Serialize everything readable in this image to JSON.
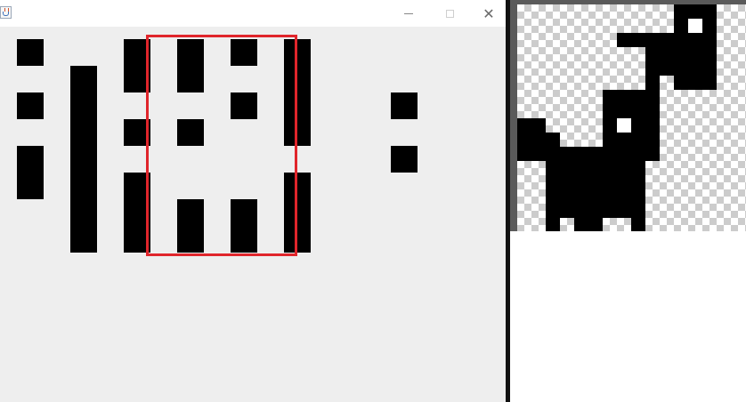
{
  "window": {
    "title": "",
    "icon": "java-cup-icon",
    "buttons": {
      "minimize": "minimize-icon",
      "maximize": "maximize-icon",
      "close": "close-icon"
    },
    "close_glyph": "✕"
  },
  "canvas": {
    "background": "#eeeeee",
    "block_color": "#000000",
    "selection_color": "#e0252b"
  },
  "preview": {
    "checker_light": "#ffffff",
    "checker_dark": "#cccccc",
    "sprites": [
      "small-creature-sprite",
      "dog-sprite"
    ]
  }
}
